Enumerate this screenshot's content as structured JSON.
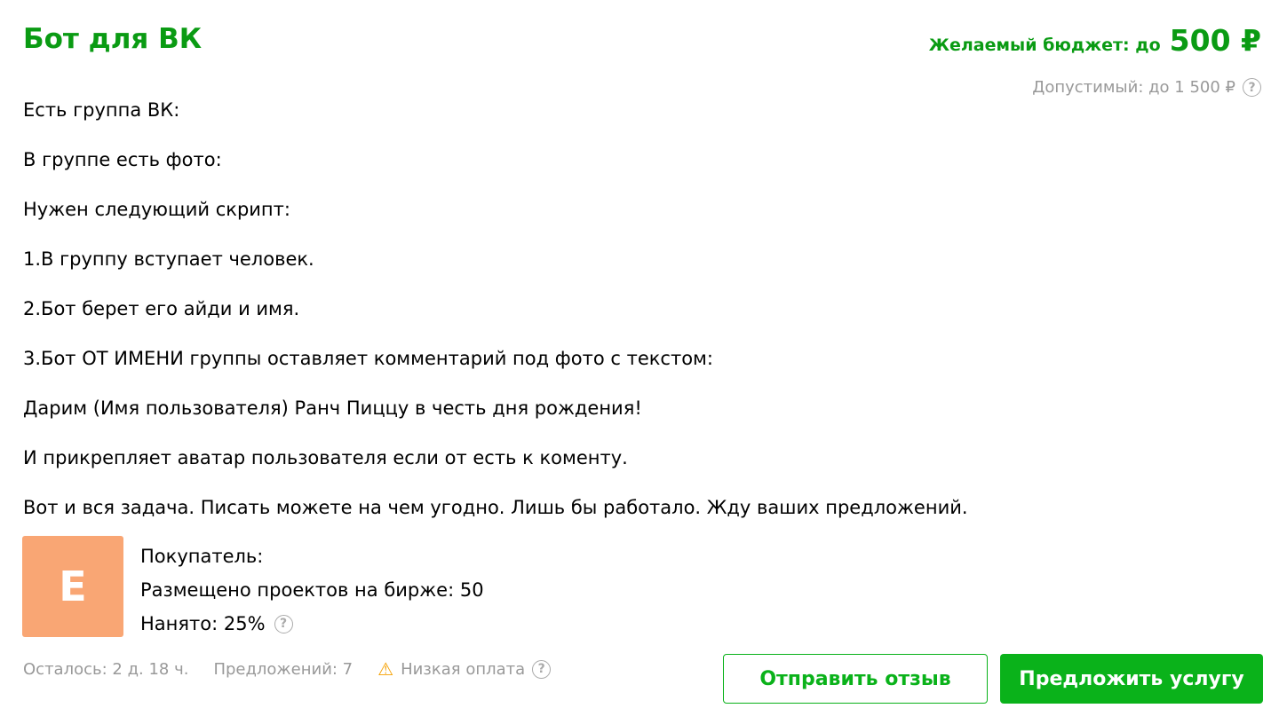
{
  "title": "Бот для ВК",
  "budget": {
    "label": "Желаемый бюджет: до",
    "amount": "500 ₽",
    "allowed": "Допустимый: до 1 500 ₽"
  },
  "description": [
    "Есть группа ВК:",
    "В группе есть фото:",
    "Нужен следующий скрипт:",
    "1.В группу вступает человек.",
    "2.Бот берет его айди и имя.",
    "3.Бот ОТ ИМЕНИ группы оставляет комментарий под фото с текстом:",
    "Дарим (Имя пользователя) Ранч Пиццу в честь дня рождения!",
    "И прикрепляет аватар пользователя если от есть к коменту.",
    "Вот и вся задача. Писать можете на чем угодно. Лишь бы работало. Жду ваших предложений."
  ],
  "buyer": {
    "avatar_letter": "E",
    "avatar_color": "#f9a674",
    "label": "Покупатель:",
    "projects": "Размещено проектов на бирже: 50",
    "hired": "Нанято: 25%"
  },
  "meta": {
    "remaining": "Осталось: 2 д. 18 ч.",
    "offers": "Предложений: 7",
    "low_pay": "Низкая оплата"
  },
  "buttons": {
    "review": "Отправить отзыв",
    "offer": "Предложить услугу"
  },
  "colors": {
    "accent": "#0ab21a",
    "warning": "#f5a000"
  }
}
